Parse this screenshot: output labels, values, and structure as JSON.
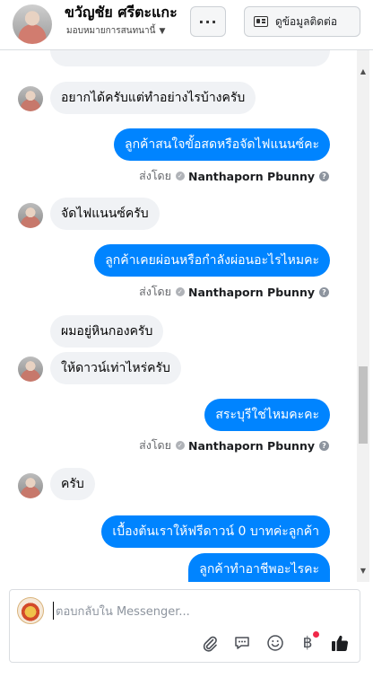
{
  "header": {
    "name": "ขวัญชัย ศรีตะแกะ",
    "subtitle": "มอบหมายการสนทนานี้",
    "contact_button": "ดูข้อมูลติดต่อ",
    "more_button": "···"
  },
  "messages": [
    {
      "dir": "in",
      "text": "อยากได้ครับแต่ทำอย่างไรบ้างครับ"
    },
    {
      "dir": "out",
      "text": "ลูกค้าสนใจขั้อสดหรือจัดไฟแนนซ์คะ",
      "sent_label": "ส่งโดย",
      "sender": "Nanthaporn Pbunny"
    },
    {
      "dir": "in",
      "text": "จัดไฟแนนซ์ครับ"
    },
    {
      "dir": "out",
      "text": "ลูกค้าเคยผ่อนหรือกำลังผ่อนอะไรไหมคะ",
      "sent_label": "ส่งโดย",
      "sender": "Nanthaporn Pbunny"
    },
    {
      "dir": "in",
      "text": "ผมอยู่หินกองครับ"
    },
    {
      "dir": "in",
      "text": "ให้ดาวน์เท่าไหร่ครับ"
    },
    {
      "dir": "out",
      "text": "สระบุรีใช่ไหมคะคะ",
      "sent_label": "ส่งโดย",
      "sender": "Nanthaporn Pbunny"
    },
    {
      "dir": "in",
      "text": "ครับ"
    },
    {
      "dir": "out",
      "text": "เบื้องต้นเราให้ฟรีดาวน์ 0 บาทค่ะลูกค้า"
    },
    {
      "dir": "out",
      "text": "ลูกค้าทำอาชีพอะไรคะ"
    }
  ],
  "composer": {
    "placeholder": "ตอบกลับใน Messenger..."
  },
  "icons": {
    "more": "more-icon",
    "contact": "id-card-icon",
    "attach": "paperclip-icon",
    "saved_replies": "chat-bubble-icon",
    "emoji": "smiley-icon",
    "payment": "baht-icon",
    "like": "thumbs-up-icon",
    "check": "check-icon",
    "help": "help-icon"
  },
  "colors": {
    "outgoing": "#0084ff",
    "incoming": "#f0f2f5",
    "like": "#1c1e21"
  }
}
